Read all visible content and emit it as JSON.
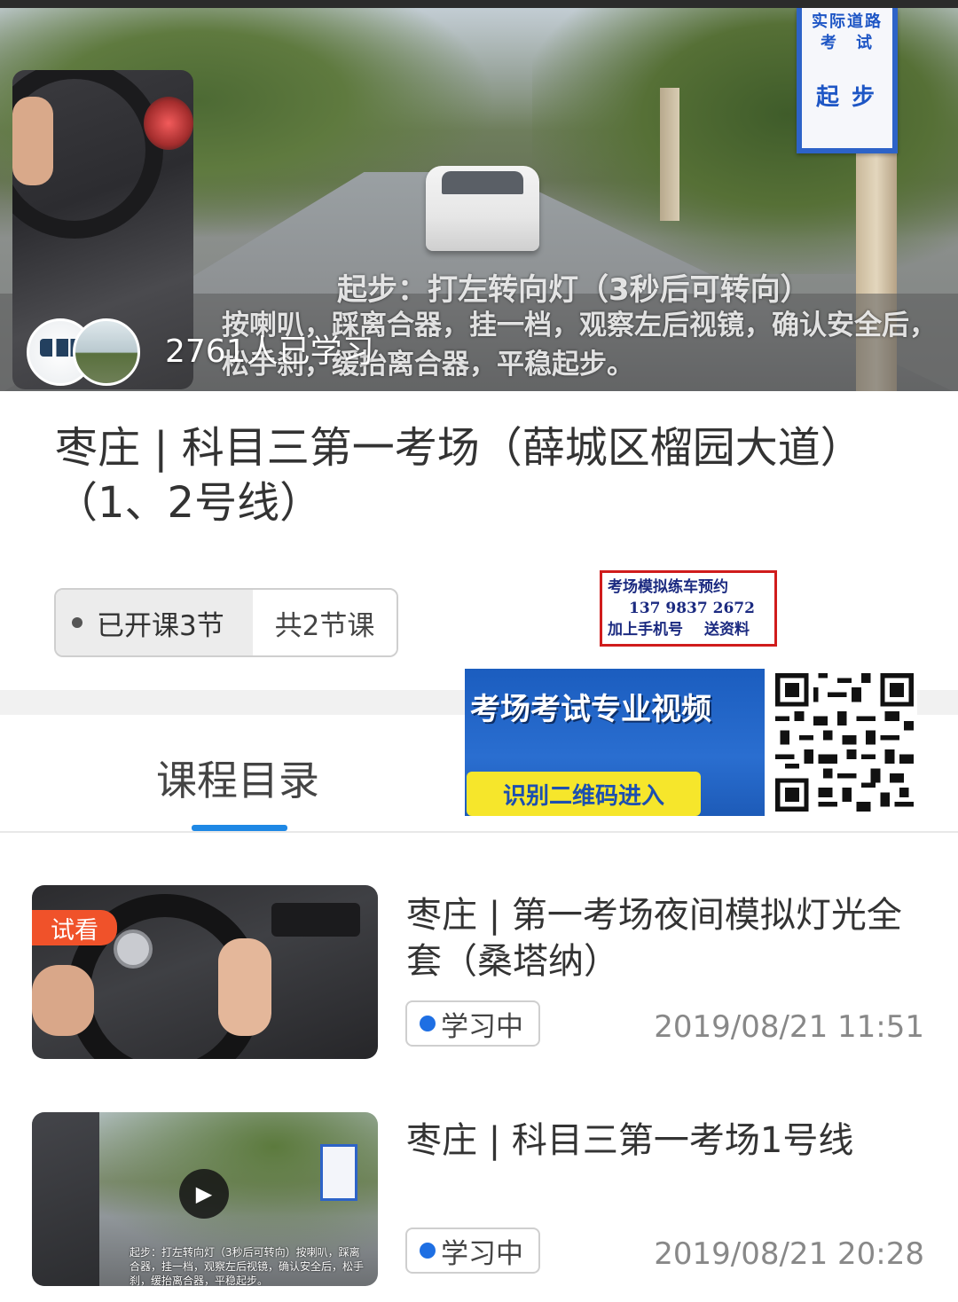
{
  "hero": {
    "sign_top": "实际道路\n考　试",
    "sign_bottom": "起步",
    "caption_line1": "起步：打左转向灯（3秒后可转向）",
    "caption_line2": "按喇叭，踩离合器，挂一档，观察左后视镜，确认安全后，松手刹，缓抬离合器，平稳起步。",
    "learners": "2761人已学习"
  },
  "course": {
    "title": "枣庄 | 科目三第一考场（薛城区榴园大道）（1、2号线）",
    "opened_label": "已开课3节",
    "total_label": "共2节课"
  },
  "promo": {
    "line1": "考场模拟练车预约",
    "line2": "137 9837 2672",
    "line3a": "加上手机号",
    "line3b": "送资料"
  },
  "banner": {
    "title": "考场考试专业视频",
    "button": "识别二维码进入"
  },
  "tabs": {
    "catalog": "课程目录"
  },
  "lessons": [
    {
      "badge": "试看",
      "title": "枣庄 | 第一考场夜间模拟灯光全套（桑塔纳）",
      "status": "学习中",
      "time": "2019/08/21 11:51"
    },
    {
      "title": "枣庄 | 科目三第一考场1号线",
      "status": "学习中",
      "time": "2019/08/21 20:28",
      "thumb_caption": "起步：打左转向灯（3秒后可转向）按喇叭，踩离合器，挂一档，观察左后视镜，确认安全后，松手刹，缓抬离合器，平稳起步。"
    }
  ],
  "colors": {
    "accent_blue": "#1e88e5",
    "status_dot": "#1e6fe3",
    "trial_badge": "#f0522a",
    "promo_border": "#d01c1c"
  }
}
